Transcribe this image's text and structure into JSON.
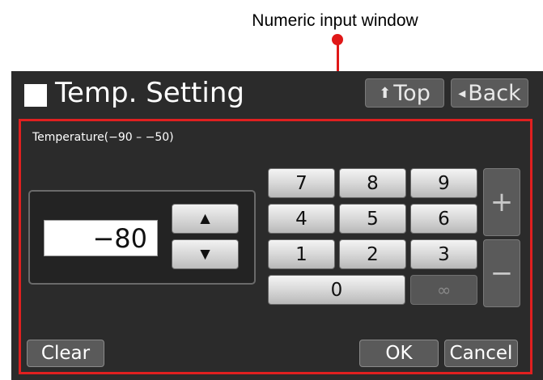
{
  "annotation": {
    "label": "Numeric input window"
  },
  "header": {
    "title": "Temp. Setting",
    "top_label": "Top",
    "top_icon": "up-arrow",
    "back_label": "Back",
    "back_icon": "left-triangle"
  },
  "field": {
    "label": "Temperature(−90 – −50)",
    "value": "−80"
  },
  "spin": {
    "up": "▲",
    "down": "▼"
  },
  "keypad": {
    "k7": "7",
    "k8": "8",
    "k9": "9",
    "k4": "4",
    "k5": "5",
    "k6": "6",
    "k1": "1",
    "k2": "2",
    "k3": "3",
    "k0": "0",
    "inf": "∞",
    "plus": "+",
    "minus": "−"
  },
  "footer": {
    "clear": "Clear",
    "ok": "OK",
    "cancel": "Cancel"
  },
  "colors": {
    "screen_bg": "#2b2b2b",
    "highlight": "#e02020"
  }
}
